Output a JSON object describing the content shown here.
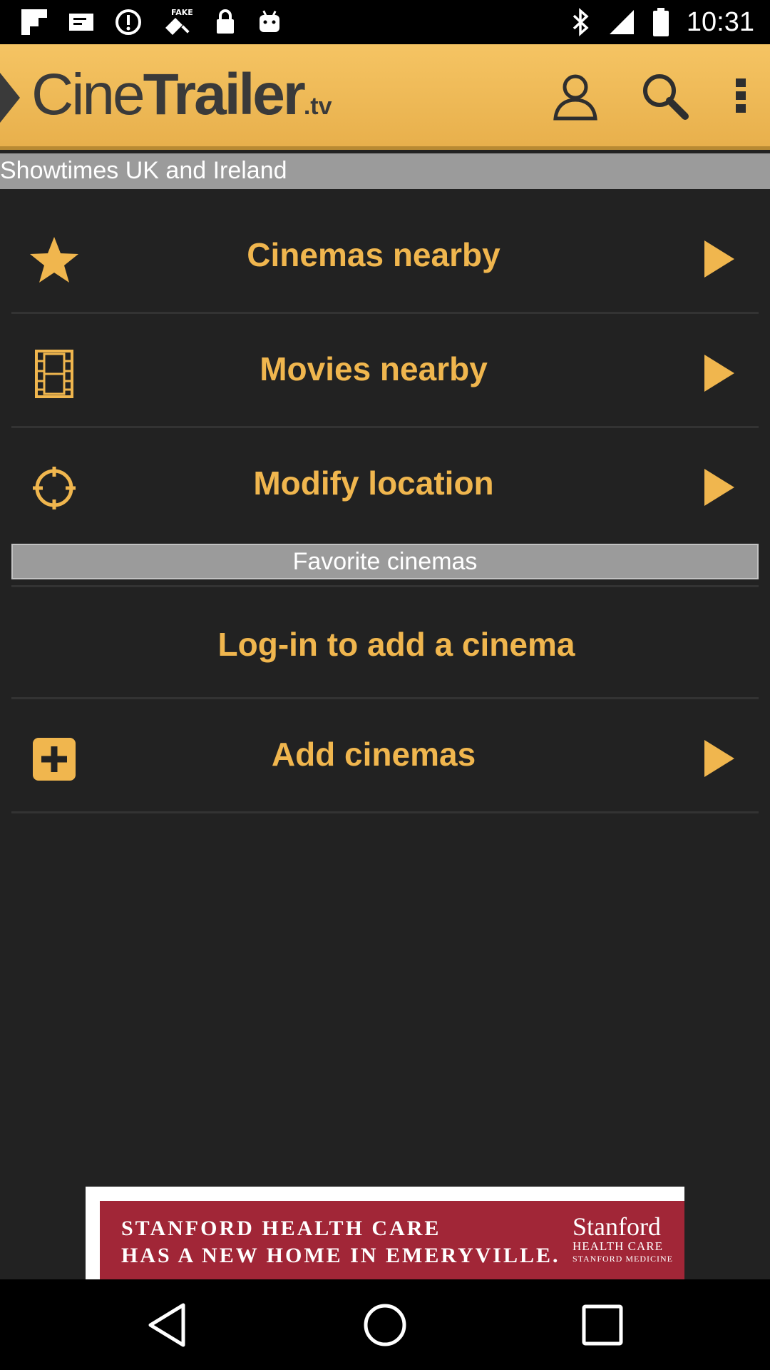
{
  "status_bar": {
    "time": "10:31"
  },
  "app_bar": {
    "logo_cine": "Cine",
    "logo_trailer": "Trailer",
    "logo_tv": ".tv",
    "icons": [
      "drawer-arrow-icon",
      "profile-icon",
      "search-icon",
      "overflow-menu-icon"
    ]
  },
  "subheader": "Showtimes UK and Ireland",
  "menu": {
    "cinemas_nearby": "Cinemas nearby",
    "movies_nearby": "Movies nearby",
    "modify_location": "Modify location"
  },
  "favorites": {
    "header": "Favorite cinemas",
    "login_prompt": "Log-in to add a cinema",
    "add_cinemas": "Add cinemas"
  },
  "ad": {
    "line1": "STANFORD HEALTH CARE",
    "line2": "HAS A NEW HOME IN EMERYVILLE.",
    "logo_line1": "Stanford",
    "logo_line2": "HEALTH CARE",
    "logo_line3": "STANFORD MEDICINE"
  },
  "colors": {
    "accent": "#f0b64e",
    "app_bar": "#f0bc5a",
    "background": "#222222",
    "section_header": "#9b9b9b",
    "ad_background": "#a12637"
  }
}
